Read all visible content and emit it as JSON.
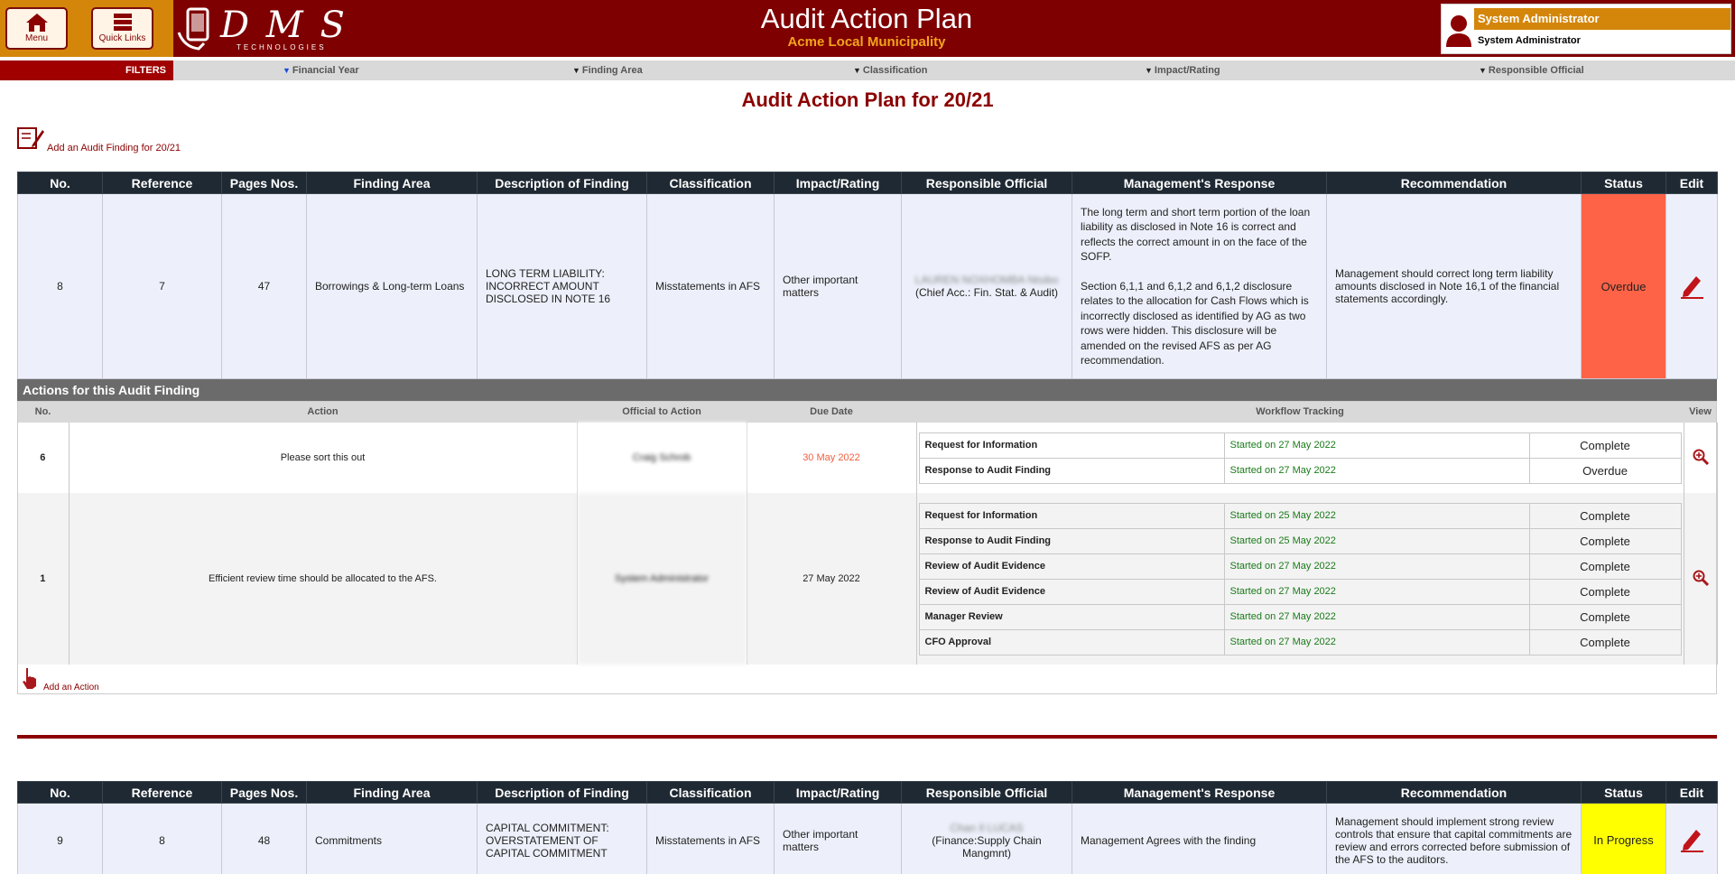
{
  "header": {
    "menu_label": "Menu",
    "quicklinks_label": "Quick Links",
    "logo_text": "D M S",
    "logo_sub": "TECHNOLOGIES",
    "title": "Audit Action Plan",
    "municipality": "Acme Local Municipality",
    "user_role": "System Administrator",
    "user_name": "System Administrator"
  },
  "filters": {
    "label": "FILTERS",
    "items": [
      "Financial Year",
      "Finding Area",
      "Classification",
      "Impact/Rating",
      "Responsible Official"
    ]
  },
  "page_title": "Audit Action Plan for 20/21",
  "add_finding_label": "Add an Audit Finding for 20/21",
  "finding_columns": [
    "No.",
    "Reference",
    "Pages Nos.",
    "Finding Area",
    "Description of Finding",
    "Classification",
    "Impact/Rating",
    "Responsible Official",
    "Management's Response",
    "Recommendation",
    "Status",
    "Edit"
  ],
  "findings": [
    {
      "no": "8",
      "reference": "7",
      "pages": "47",
      "area": "Borrowings & Long-term Loans",
      "description": "LONG TERM LIABILITY: INCORRECT AMOUNT DISCLOSED IN NOTE 16",
      "classification": "Misstatements in AFS",
      "impact": "Other important matters",
      "official_name": "LAUREN NOXHOMBA Ntsibo",
      "official_title": "(Chief Acc.: Fin. Stat. & Audit)",
      "response_p1": "The long term and short term portion of the loan liability as disclosed in Note 16 is correct and reflects the correct amount in on the face of the SOFP.",
      "response_p2": "Section 6,1,1 and 6,1,2 and 6,1,2 disclosure relates to the allocation for Cash Flows which is incorrectly disclosed as identified by AG as two rows were hidden.  This disclosure will be amended on the revised AFS as per AG recommendation.",
      "recommendation": "Management should correct long term liability amounts disclosed in Note 16,1 of the financial statements accordingly.",
      "status": "Overdue"
    },
    {
      "no": "9",
      "reference": "8",
      "pages": "48",
      "area": "Commitments",
      "description": "CAPITAL COMMITMENT: OVERSTATEMENT OF CAPITAL COMMITMENT",
      "classification": "Misstatements in AFS",
      "impact": "Other important matters",
      "official_name": "Chan Il LUCAS",
      "official_title": "(Finance:Supply Chain Mangmnt)",
      "response_p1": "Management Agrees with the finding",
      "recommendation": "Management should implement strong review controls that ensure that capital commitments are review and errors corrected before submission of the AFS to the auditors.",
      "status": "In Progress"
    }
  ],
  "actions_heading": "Actions for this Audit Finding",
  "action_columns": [
    "No.",
    "Action",
    "Official to Action",
    "Due Date",
    "Workflow Tracking",
    "View"
  ],
  "actions": [
    {
      "no": "6",
      "action": "Please sort this out",
      "official": "Craig Schrob",
      "due": "30 May 2022",
      "workflow": [
        {
          "step": "Request for Information",
          "started": "Started on 27 May 2022",
          "status": "Complete"
        },
        {
          "step": "Response to Audit Finding",
          "started": "Started on 27 May 2022",
          "status": "Overdue"
        }
      ]
    },
    {
      "no": "1",
      "action": "Efficient review time should be allocated to the AFS.",
      "official": "System Administrator",
      "due": "27 May 2022",
      "workflow": [
        {
          "step": "Request for Information",
          "started": "Started on 25 May 2022",
          "status": "Complete"
        },
        {
          "step": "Response to Audit Finding",
          "started": "Started on 25 May 2022",
          "status": "Complete"
        },
        {
          "step": "Review of Audit Evidence",
          "started": "Started on 27 May 2022",
          "status": "Complete"
        },
        {
          "step": "Review of Audit Evidence",
          "started": "Started on 27 May 2022",
          "status": "Complete"
        },
        {
          "step": "Manager Review",
          "started": "Started on 27 May 2022",
          "status": "Complete"
        },
        {
          "step": "CFO Approval",
          "started": "Started on 27 May 2022",
          "status": "Complete"
        }
      ]
    }
  ],
  "add_action_label": "Add an Action",
  "colors": {
    "header": "#7f0000",
    "accent": "#d4860b",
    "overdue": "#ff6347",
    "complete": "#90ee90",
    "in_progress": "#ffff00"
  }
}
